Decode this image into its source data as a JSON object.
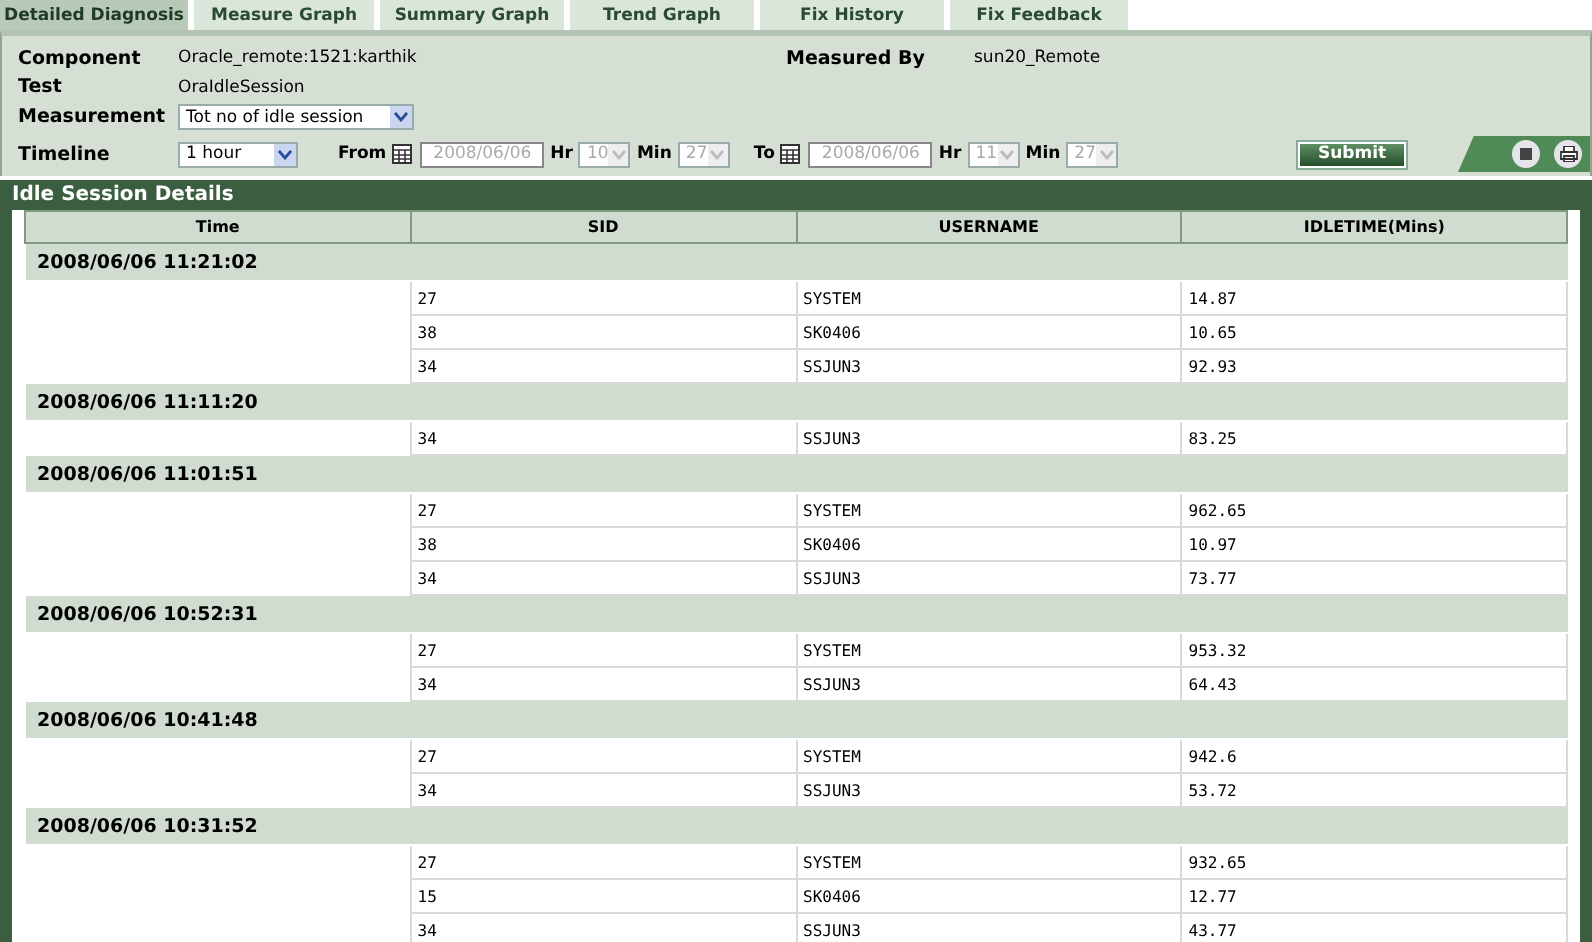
{
  "tabs": [
    {
      "label": "Detailed Diagnosis",
      "selected": true
    },
    {
      "label": "Measure Graph",
      "selected": false
    },
    {
      "label": "Summary Graph",
      "selected": false
    },
    {
      "label": "Trend Graph",
      "selected": false
    },
    {
      "label": "Fix History",
      "selected": false
    },
    {
      "label": "Fix Feedback",
      "selected": false
    }
  ],
  "info": {
    "component_label": "Component",
    "component": "Oracle_remote:1521:karthik",
    "measured_by_label": "Measured By",
    "measured_by": "sun20_Remote",
    "test_label": "Test",
    "test": "OraIdleSession",
    "measurement_label": "Measurement",
    "measurement": "Tot no of idle session",
    "timeline_label": "Timeline",
    "timeline": "1 hour"
  },
  "range": {
    "from_label": "From",
    "from_date": "2008/06/06",
    "from_hr_label": "Hr",
    "from_hr": "10",
    "from_min_label": "Min",
    "from_min": "27",
    "to_label": "To",
    "to_date": "2008/06/06",
    "to_hr_label": "Hr",
    "to_hr": "11",
    "to_min_label": "Min",
    "to_min": "27",
    "disabled": true
  },
  "submit": "Submit",
  "section_title": "Idle Session Details",
  "table": {
    "columns": [
      "Time",
      "SID",
      "USERNAME",
      "IDLETIME(Mins)"
    ],
    "groups": [
      {
        "time": "2008/06/06 11:21:02",
        "rows": [
          [
            "27",
            "SYSTEM",
            "14.87"
          ],
          [
            "38",
            "SK0406",
            "10.65"
          ],
          [
            "34",
            "SSJUN3",
            "92.93"
          ]
        ]
      },
      {
        "time": "2008/06/06 11:11:20",
        "rows": [
          [
            "34",
            "SSJUN3",
            "83.25"
          ]
        ]
      },
      {
        "time": "2008/06/06 11:01:51",
        "rows": [
          [
            "27",
            "SYSTEM",
            "962.65"
          ],
          [
            "38",
            "SK0406",
            "10.97"
          ],
          [
            "34",
            "SSJUN3",
            "73.77"
          ]
        ]
      },
      {
        "time": "2008/06/06 10:52:31",
        "rows": [
          [
            "27",
            "SYSTEM",
            "953.32"
          ],
          [
            "34",
            "SSJUN3",
            "64.43"
          ]
        ]
      },
      {
        "time": "2008/06/06 10:41:48",
        "rows": [
          [
            "27",
            "SYSTEM",
            "942.6"
          ],
          [
            "34",
            "SSJUN3",
            "53.72"
          ]
        ]
      },
      {
        "time": "2008/06/06 10:31:52",
        "rows": [
          [
            "27",
            "SYSTEM",
            "932.65"
          ],
          [
            "15",
            "SK0406",
            "12.77"
          ],
          [
            "34",
            "SSJUN3",
            "43.77"
          ]
        ]
      }
    ]
  }
}
